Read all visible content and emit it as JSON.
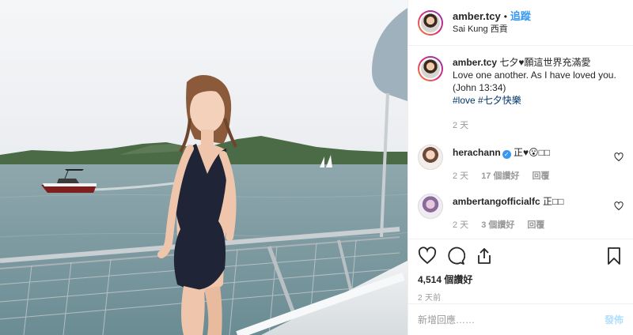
{
  "header": {
    "username": "amber.tcy",
    "separator": "•",
    "follow_label": "追蹤",
    "location": "Sai Kung 西貢",
    "more_label": "···"
  },
  "caption": {
    "username": "amber.tcy",
    "text": "七夕♥願這世界充滿愛",
    "line2": "Love one another. As I have loved you.",
    "line3": "(John 13:34)",
    "hashtags": "#love #七夕快樂",
    "time": "2 天"
  },
  "comments": [
    {
      "username": "herachann",
      "verified": "✓",
      "text": "正♥😮□□",
      "time": "2 天",
      "likes": "17 個讚好",
      "reply": "回覆"
    },
    {
      "username": "ambertangofficialfc",
      "text": "正□□",
      "time": "2 天",
      "likes": "3 個讚好",
      "reply": "回覆"
    }
  ],
  "actions": {
    "likes": "4,514 個讚好",
    "posted": "2 天前"
  },
  "add_comment": {
    "placeholder": "新增回應……",
    "post_label": "發佈"
  },
  "icons": {
    "like": "heart-icon",
    "comment": "comment-icon",
    "share": "share-icon",
    "save": "bookmark-icon"
  }
}
